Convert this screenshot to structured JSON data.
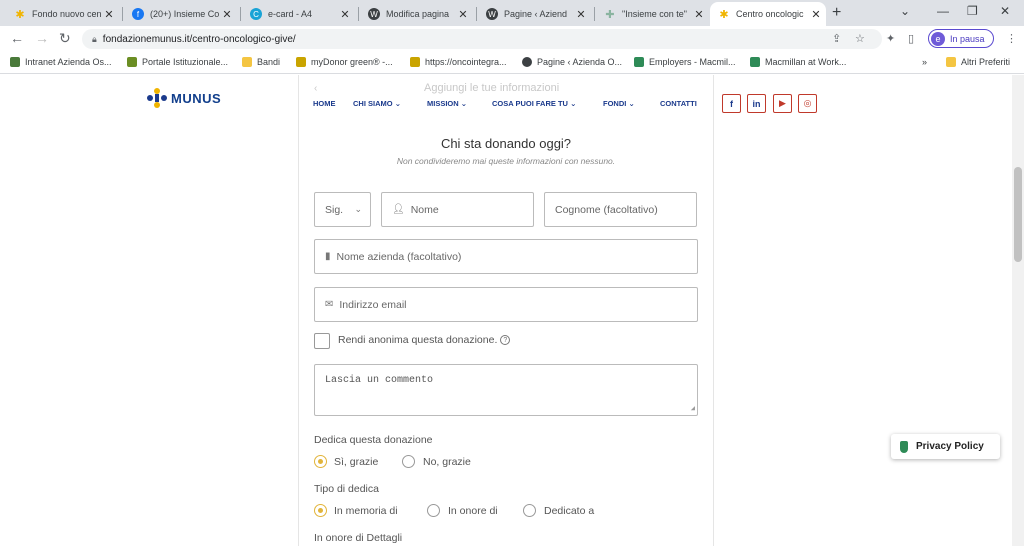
{
  "tabs": [
    {
      "title": "Fondo nuovo cen",
      "favicon": "munus-icon",
      "color": "#f0b400"
    },
    {
      "title": "(20+) Insieme Co",
      "favicon": "facebook-icon",
      "color": "#1877f2"
    },
    {
      "title": "e-card - A4",
      "favicon": "canva-icon",
      "color": "#19a3d6"
    },
    {
      "title": "Modifica pagina",
      "favicon": "wordpress-icon",
      "color": "#3c4043"
    },
    {
      "title": "Pagine ‹ Aziend",
      "favicon": "wordpress-icon",
      "color": "#3c4043"
    },
    {
      "title": "\"Insieme con te\"",
      "favicon": "grid-icon",
      "color": "#8ab4a0"
    },
    {
      "title": "Centro oncologic",
      "favicon": "munus-icon",
      "color": "#f0b400"
    }
  ],
  "browser": {
    "url": "fondazionemunus.it/centro-oncologico-give/",
    "profile_label": "In pausa",
    "profile_initial": "e"
  },
  "bookmarks": [
    {
      "label": "Intranet Azienda Os...",
      "color": "#4a7a3a"
    },
    {
      "label": "Portale Istituzionale...",
      "color": "#6b8e23"
    },
    {
      "label": "Bandi",
      "color": "#f4c542"
    },
    {
      "label": "myDonor green® -...",
      "color": "#c9a400"
    },
    {
      "label": "https://oncointegra...",
      "color": "#c9a400"
    },
    {
      "label": "Pagine ‹ Azienda O...",
      "color": "#3c4043"
    },
    {
      "label": "Employers - Macmil...",
      "color": "#2e8b57"
    },
    {
      "label": "Macmillan at Work...",
      "color": "#2e8b57"
    }
  ],
  "bookmarks_more": "»",
  "bookmarks_other": "Altri Preferiti",
  "site": {
    "logo_text": "MUNUS",
    "menu": [
      {
        "label": "HOME"
      },
      {
        "label": "CHI SIAMO"
      },
      {
        "label": "MISSION"
      },
      {
        "label": "COSA PUOI FARE TU"
      },
      {
        "label": "FONDI"
      },
      {
        "label": "CONTATTI"
      }
    ],
    "social": [
      {
        "label": "f",
        "name": "facebook-icon",
        "color": "#1b3a8c"
      },
      {
        "label": "in",
        "name": "linkedin-icon",
        "color": "#1b3a8c"
      },
      {
        "label": "▶",
        "name": "youtube-icon",
        "color": "#c0392b"
      },
      {
        "label": "◎",
        "name": "instagram-icon",
        "color": "#c0392b"
      }
    ]
  },
  "form": {
    "back_hint": "‹",
    "add_info": "Aggiungi le tue informazioni",
    "heading": "Chi sta donando oggi?",
    "subheading": "Non condivideremo mai queste informazioni con nessuno.",
    "title_select": "Sig.",
    "first_name_placeholder": "Nome",
    "last_name_placeholder": "Cognome (facoltativo)",
    "company_placeholder": "Nome azienda (facoltativo)",
    "email_placeholder": "Indirizzo email",
    "anonymous_label": "Rendi anonima questa donazione.",
    "comment_placeholder": "Lascia un commento",
    "dedicate_label": "Dedica questa donazione",
    "dedicate_options": [
      "Sì, grazie",
      "No, grazie"
    ],
    "dedication_type_label": "Tipo di dedica",
    "dedication_type_options": [
      "In memoria di",
      "In onore di",
      "Dedicato a"
    ],
    "honoree_label": "In onore di Dettagli"
  },
  "privacy_label": "Privacy Policy"
}
